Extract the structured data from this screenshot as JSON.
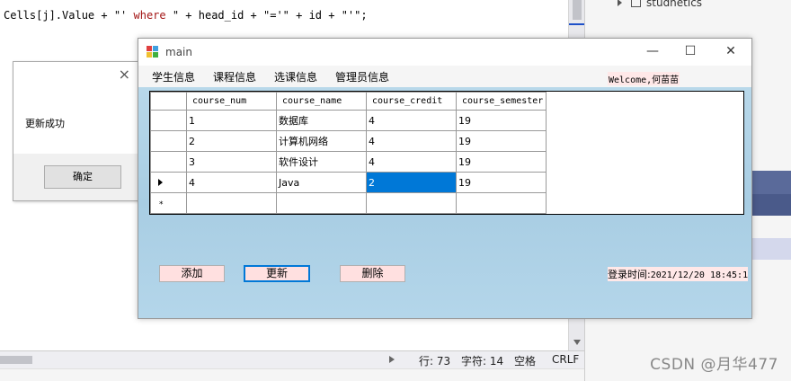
{
  "editor": {
    "code": {
      "part1": "Cells[j].Value + \"'",
      "keyword": " where ",
      "part2": "\" + head_id + \"='\" + id + \"'\";"
    }
  },
  "statusbar": {
    "line": "行: 73",
    "char": "字符: 14",
    "space": "空格",
    "eol": "CRLF"
  },
  "solution_tree": {
    "item": "studnetics"
  },
  "watermark": "CSDN @月华477",
  "msgbox": {
    "close_glyph": "×",
    "message": "更新成功",
    "ok_label": "确定"
  },
  "main_window": {
    "title": "main",
    "minimize_glyph": "—",
    "maximize_glyph": "☐",
    "close_glyph": "✕",
    "menu": [
      "学生信息",
      "课程信息",
      "选课信息",
      "管理员信息"
    ],
    "welcome": "Welcome,何苗苗",
    "grid": {
      "columns": [
        "course_num",
        "course_name",
        "course_credit",
        "course_semester"
      ],
      "rows": [
        [
          "1",
          "数据库",
          "4",
          "19"
        ],
        [
          "2",
          "计算机网络",
          "4",
          "19"
        ],
        [
          "3",
          "软件设计",
          "4",
          "19"
        ],
        [
          "4",
          "Java",
          "2",
          "19"
        ]
      ],
      "current_row": 3,
      "selected_cell": [
        3,
        2
      ],
      "new_row_glyph": "*"
    },
    "buttons": {
      "add": "添加",
      "update": "更新",
      "delete": "删除"
    },
    "login_label": "登录时间:",
    "login_time": "2021/12/20 18:45:1"
  },
  "colors": {
    "selection": "#0078d7",
    "client_bg": "#b8d8ea",
    "button_bg": "#ffe0e0"
  }
}
